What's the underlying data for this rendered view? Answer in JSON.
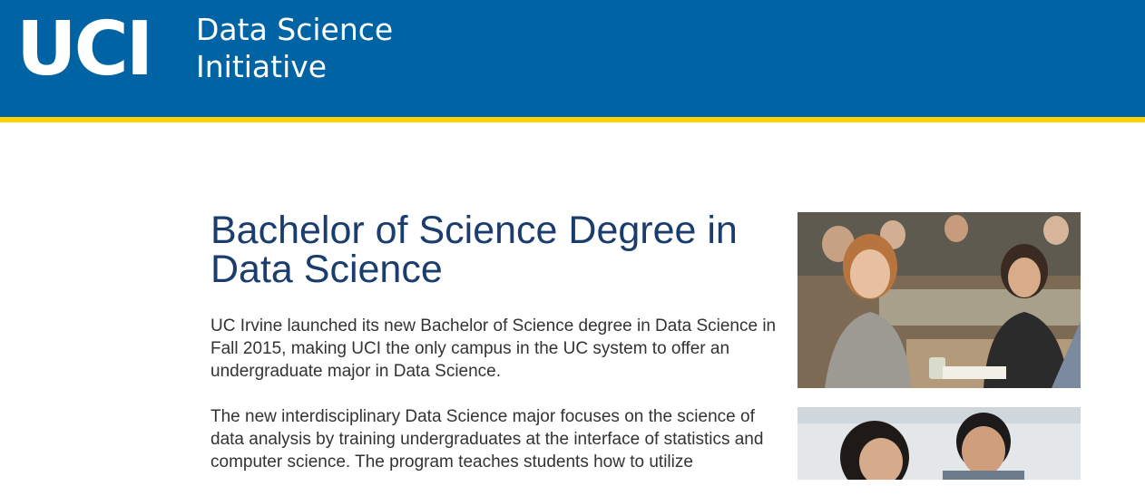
{
  "header": {
    "logo_text": "UCI",
    "site_name_line1": "Data Science",
    "site_name_line2": "Initiative",
    "colors": {
      "header_blue": "#0064a4",
      "stripe_gold": "#ffd200"
    }
  },
  "main": {
    "title": "Bachelor of Science Degree in Data Science",
    "paragraphs": [
      "UC Irvine launched its new Bachelor of Science degree in Data Science in Fall 2015, making UCI the only campus in the UC system to offer an undergraduate major in Data Science.",
      "The new interdisciplinary Data Science major focuses on the science of data analysis by training undergraduates at the interface of statistics and computer science. The program teaches students how to utilize"
    ],
    "title_color": "#1b3d6d"
  },
  "sidebar": {
    "photos": [
      {
        "icon": "classroom-students-photo"
      },
      {
        "icon": "students-working-photo"
      }
    ]
  }
}
